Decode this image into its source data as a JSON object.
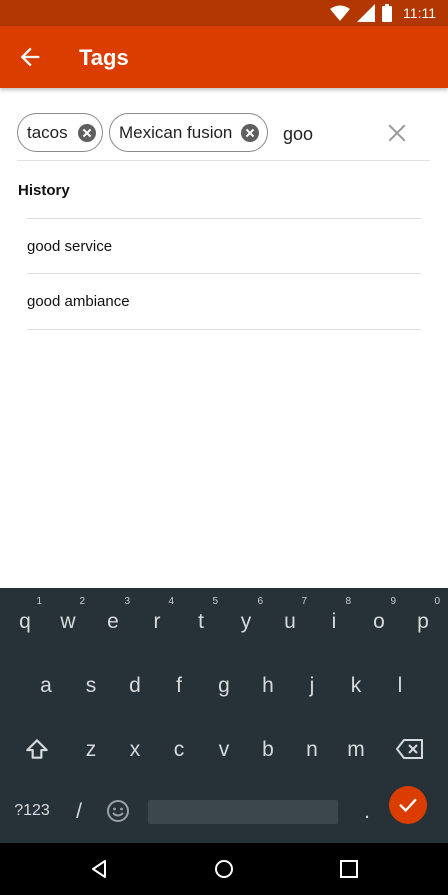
{
  "status_bar": {
    "time": "11:11",
    "icons": [
      "wifi-icon",
      "cell-signal-icon",
      "battery-icon"
    ]
  },
  "app_bar": {
    "title": "Tags",
    "back_icon": "arrow-back-icon",
    "background_color": "#db3d00",
    "status_color": "#b23600"
  },
  "tag_input": {
    "chips": [
      {
        "label": "tacos"
      },
      {
        "label": "Mexican fusion"
      }
    ],
    "value": "goo",
    "clear_icon": "close-icon"
  },
  "history": {
    "label": "History",
    "items": [
      {
        "label": "good service"
      },
      {
        "label": "good ambiance"
      }
    ]
  },
  "keyboard": {
    "row1": [
      {
        "key": "q",
        "hint": "1"
      },
      {
        "key": "w",
        "hint": "2"
      },
      {
        "key": "e",
        "hint": "3"
      },
      {
        "key": "r",
        "hint": "4"
      },
      {
        "key": "t",
        "hint": "5"
      },
      {
        "key": "y",
        "hint": "6"
      },
      {
        "key": "u",
        "hint": "7"
      },
      {
        "key": "i",
        "hint": "8"
      },
      {
        "key": "o",
        "hint": "9"
      },
      {
        "key": "p",
        "hint": "0"
      }
    ],
    "row2": [
      "a",
      "s",
      "d",
      "f",
      "g",
      "h",
      "j",
      "k",
      "l"
    ],
    "row3": [
      "z",
      "x",
      "c",
      "v",
      "b",
      "n",
      "m"
    ],
    "symbols_label": "?123",
    "slash": "/",
    "period": ".",
    "accent_color": "#db3d00",
    "background_color": "#263238"
  },
  "nav_bar": {
    "icons": [
      "nav-back-icon",
      "home-icon",
      "recents-icon"
    ]
  }
}
